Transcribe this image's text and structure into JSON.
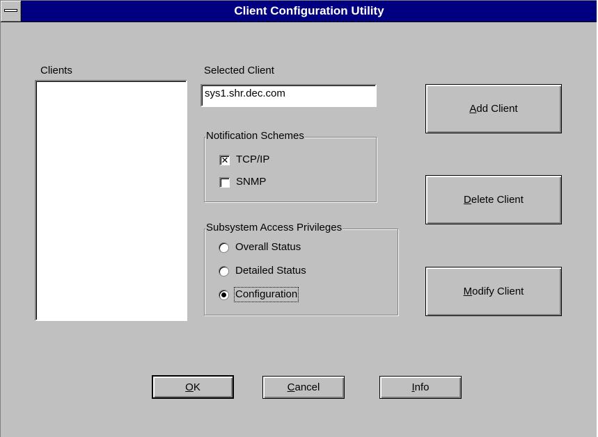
{
  "window": {
    "title": "Client Configuration Utility"
  },
  "clients": {
    "label": "Clients",
    "items": []
  },
  "selected_client": {
    "label": "Selected Client",
    "value": "sys1.shr.dec.com"
  },
  "notification": {
    "title": "Notification Schemes",
    "options": [
      {
        "label": "TCP/IP",
        "checked": true,
        "mark": "✕"
      },
      {
        "label": "SNMP",
        "checked": false,
        "mark": ""
      }
    ]
  },
  "access": {
    "title": "Subsystem Access Privileges",
    "options": [
      {
        "label": "Overall Status",
        "selected": false
      },
      {
        "label": "Detailed Status",
        "selected": false
      },
      {
        "label": "Configuration",
        "selected": true
      }
    ]
  },
  "buttons": {
    "add": {
      "accel": "A",
      "rest": "dd Client"
    },
    "delete": {
      "accel": "D",
      "rest": "elete Client"
    },
    "modify": {
      "accel": "M",
      "rest": "odify Client"
    },
    "ok": {
      "accel": "O",
      "rest": "K"
    },
    "cancel": {
      "accel": "C",
      "rest": "ancel"
    },
    "info": {
      "accel": "I",
      "rest": "nfo"
    }
  }
}
